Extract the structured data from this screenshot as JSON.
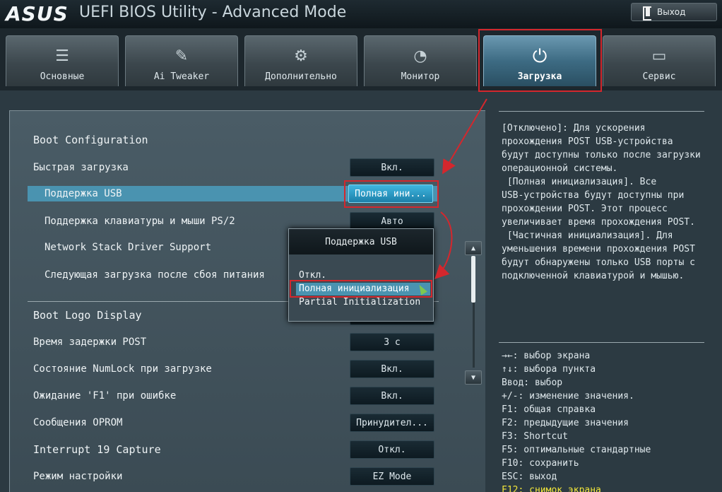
{
  "header": {
    "logo": "ASUS",
    "title": "UEFI BIOS Utility - Advanced Mode",
    "exit_label": "Выход"
  },
  "tabs": [
    {
      "label": "Основные",
      "icon": "list-icon"
    },
    {
      "label": "Ai Tweaker",
      "icon": "tweaker-icon"
    },
    {
      "label": "Дополнительно",
      "icon": "advanced-icon"
    },
    {
      "label": "Монитор",
      "icon": "monitor-gauge-icon"
    },
    {
      "label": "Загрузка",
      "icon": "power-icon",
      "active": true
    },
    {
      "label": "Сервис",
      "icon": "toolbox-icon"
    }
  ],
  "main": {
    "section_boot_config": "Boot Configuration",
    "settings": [
      {
        "label": "Быстрая загрузка",
        "value": "Вкл."
      },
      {
        "label": "Поддержка USB",
        "value": "Полная ини..."
      },
      {
        "label": "Поддержка клавиатуры и мыши PS/2",
        "value": "Авто"
      },
      {
        "label": "Network Stack Driver Support",
        "value": ""
      },
      {
        "label": "Следующая загрузка после сбоя питания",
        "value": ""
      },
      {
        "label": "Boot Logo Display",
        "value": ""
      },
      {
        "label": "Время задержки POST",
        "value": "3 с"
      },
      {
        "label": "Состояние NumLock при загрузке",
        "value": "Вкл."
      },
      {
        "label": "Ожидание 'F1' при ошибке",
        "value": "Вкл."
      },
      {
        "label": "Сообщения OPROM",
        "value": "Принудител..."
      },
      {
        "label": "Interrupt 19 Capture",
        "value": "Откл."
      },
      {
        "label": "Режим настройки",
        "value": "EZ Mode"
      }
    ]
  },
  "popup": {
    "title": "Поддержка USB",
    "options": [
      "Откл.",
      "Полная инициализация",
      "Partial Initialization"
    ]
  },
  "help": {
    "text": "[Отключено]: Для ускорения\nпрохождения POST USB-устройства\nбудут доступны только после загрузки\nоперационной системы.\n [Полная инициализация]. Все\nUSB-устройства будут доступны при\nпрохождении POST. Этот процесс\nувеличивает время прохождения POST.\n [Частичная инициализация]. Для\nуменьшения времени прохождения POST\nбудут обнаружены только USB порты с\nподключенной клавиатурой и мышью.",
    "keys": [
      "→←: выбор экрана",
      "↑↓: выбора пункта",
      "Ввод: выбор",
      "+/-: изменение значения.",
      "F1: общая справка",
      "F2: предыдущие значения",
      "F3: Shortcut",
      "F5: оптимальные стандартные",
      "F10: сохранить",
      "ESC: выход",
      "F12: снимок экрана"
    ]
  },
  "colors": {
    "accent": "#4a93b0",
    "annotation_red": "#d4272d",
    "hotkey_yellow": "#f2e63a"
  }
}
